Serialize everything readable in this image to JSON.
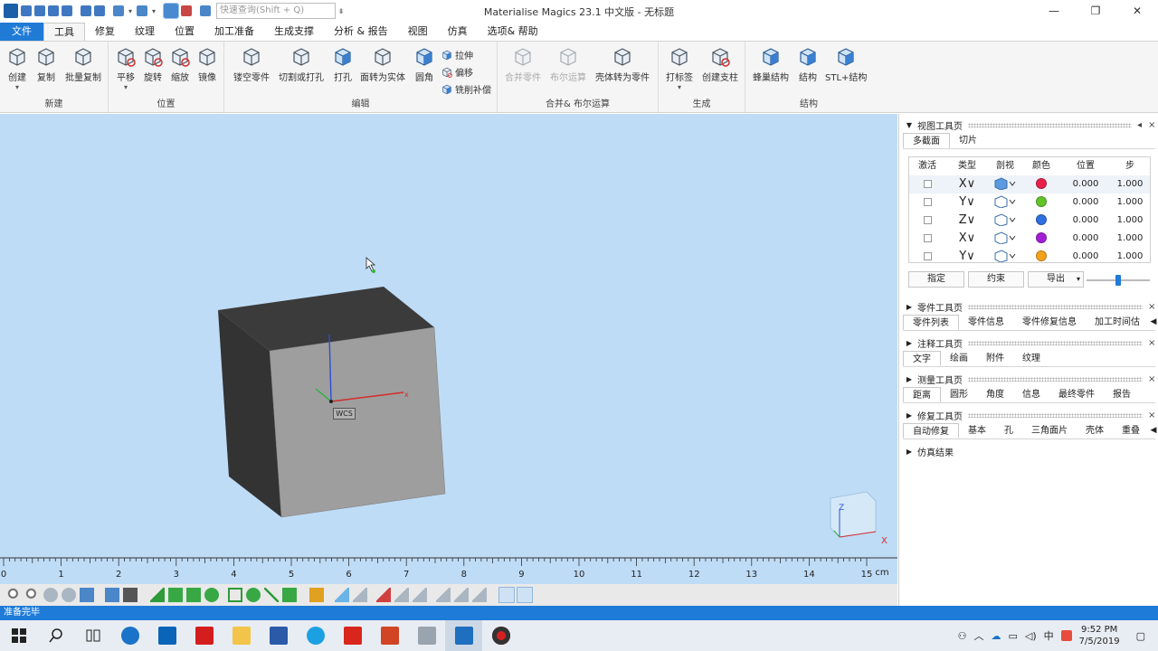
{
  "titlebar": {
    "search_placeholder": "快速查询(Shift + Q)",
    "app_title": "Materialise Magics 23.1 中文版 - 无标题",
    "minimize": "—",
    "restore": "❐",
    "close": "✕"
  },
  "menu": {
    "tabs": [
      "文件",
      "工具",
      "修复",
      "纹理",
      "位置",
      "加工准备",
      "生成支撑",
      "分析 & 报告",
      "视图",
      "仿真",
      "选项& 帮助"
    ],
    "active_index": 1
  },
  "ribbon": {
    "groups": {
      "new": "新建",
      "position": "位置",
      "edit": "编辑",
      "boolean": "合并& 布尔运算",
      "generate": "生成",
      "structure": "结构"
    },
    "tools": {
      "create": "创建",
      "copy": "复制",
      "batch_copy": "批量复制",
      "translate": "平移",
      "rotate": "旋转",
      "scale": "缩放",
      "mirror": "镜像",
      "hollow": "镂空零件",
      "cut_punch": "切割或打孔",
      "punch": "打孔",
      "surface_to_solid": "面转为实体",
      "fillet": "圆角",
      "extrude": "拉伸",
      "offset": "偏移",
      "milling_comp": "铣削补偿",
      "merge": "合并零件",
      "boolean": "布尔运算",
      "shell_to_part": "壳体转为零件",
      "label": "打标签",
      "create_support": "创建支柱",
      "honeycomb": "蜂巢结构",
      "structure": "结构",
      "stl_structure": "STL+结构"
    }
  },
  "viewport": {
    "wcs_label": "WCS",
    "axis_x": "x",
    "triad_z": "Z",
    "triad_x": "X"
  },
  "ruler": {
    "ticks": [
      "0",
      "1",
      "2",
      "3",
      "4",
      "5",
      "6",
      "7",
      "8",
      "9",
      "10",
      "11",
      "12",
      "13",
      "14",
      "15"
    ],
    "unit": "cm"
  },
  "status": {
    "text": "准备完毕"
  },
  "panel": {
    "view_page": {
      "title": "视图工具页",
      "tabs": [
        "多截面",
        "切片"
      ],
      "headers": [
        "激活",
        "类型",
        "剖视",
        "颜色",
        "位置",
        "步"
      ],
      "rows": [
        {
          "type": "X∨",
          "color": "#e8214a",
          "position": "0.000",
          "step": "1.000"
        },
        {
          "type": "Y∨",
          "color": "#62c42b",
          "position": "0.000",
          "step": "1.000"
        },
        {
          "type": "Z∨",
          "color": "#2f70e0",
          "position": "0.000",
          "step": "1.000"
        },
        {
          "type": "X∨",
          "color": "#a21fd6",
          "position": "0.000",
          "step": "1.000"
        },
        {
          "type": "Y∨",
          "color": "#f4a21a",
          "position": "0.000",
          "step": "1.000"
        }
      ],
      "buttons": {
        "assign": "指定",
        "constrain": "约束",
        "export": "导出"
      }
    },
    "part_page": {
      "title": "零件工具页",
      "tabs": [
        "零件列表",
        "零件信息",
        "零件修复信息",
        "加工时间估"
      ]
    },
    "annotation_page": {
      "title": "注释工具页",
      "tabs": [
        "文字",
        "绘画",
        "附件",
        "纹理"
      ]
    },
    "measure_page": {
      "title": "测量工具页",
      "tabs": [
        "距离",
        "圆形",
        "角度",
        "信息",
        "最终零件",
        "报告"
      ]
    },
    "repair_page": {
      "title": "修复工具页",
      "tabs": [
        "自动修复",
        "基本",
        "孔",
        "三角面片",
        "壳体",
        "重叠"
      ]
    },
    "sim_results": {
      "title": "仿真结果"
    }
  },
  "taskbar": {
    "time": "9:52 PM",
    "date": "7/5/2019",
    "ime": "中"
  }
}
